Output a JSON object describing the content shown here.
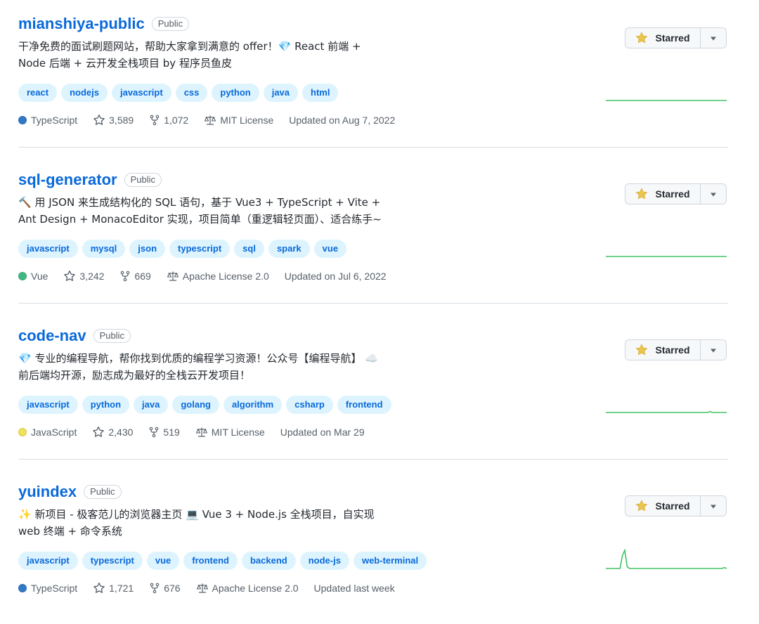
{
  "repos": [
    {
      "name": "mianshiya-public",
      "visibility": "Public",
      "description_line1": "干净免费的面试刷题网站，帮助大家拿到满意的 offer！💎 React 前端 +",
      "description_line2": "Node 后端 + 云开发全栈项目 by 程序员鱼皮",
      "topics": [
        "react",
        "nodejs",
        "javascript",
        "css",
        "python",
        "java",
        "html"
      ],
      "language": "TypeScript",
      "language_color": "#3178c6",
      "stars": "3,589",
      "forks": "1,072",
      "license": "MIT License",
      "updated": "Updated on Aug 7, 2022",
      "star_label": "Starred"
    },
    {
      "name": "sql-generator",
      "visibility": "Public",
      "description_line1": "🔨 用 JSON 来生成结构化的 SQL 语句，基于 Vue3 + TypeScript + Vite +",
      "description_line2": "Ant Design + MonacoEditor 实现，项目简单（重逻辑轻页面）、适合练手~",
      "topics": [
        "javascript",
        "mysql",
        "json",
        "typescript",
        "sql",
        "spark",
        "vue"
      ],
      "language": "Vue",
      "language_color": "#41b883",
      "stars": "3,242",
      "forks": "669",
      "license": "Apache License 2.0",
      "updated": "Updated on Jul 6, 2022",
      "star_label": "Starred"
    },
    {
      "name": "code-nav",
      "visibility": "Public",
      "description_line1": "💎 专业的编程导航，帮你找到优质的编程学习资源！公众号【编程导航】 ☁️",
      "description_line2": "前后端均开源，励志成为最好的全栈云开发项目！",
      "topics": [
        "javascript",
        "python",
        "java",
        "golang",
        "algorithm",
        "csharp",
        "frontend"
      ],
      "language": "JavaScript",
      "language_color": "#f1e05a",
      "stars": "2,430",
      "forks": "519",
      "license": "MIT License",
      "updated": "Updated on Mar 29",
      "star_label": "Starred"
    },
    {
      "name": "yuindex",
      "visibility": "Public",
      "description_line1": "✨ 新项目 - 极客范儿的浏览器主页 💻 Vue 3 + Node.js 全栈项目，自实现",
      "description_line2": "web 终端 + 命令系统",
      "topics": [
        "javascript",
        "typescript",
        "vue",
        "frontend",
        "backend",
        "node-js",
        "web-terminal"
      ],
      "language": "TypeScript",
      "language_color": "#3178c6",
      "stars": "1,721",
      "forks": "676",
      "license": "Apache License 2.0",
      "updated": "Updated last week",
      "star_label": "Starred"
    }
  ],
  "colors": {
    "link": "#0969da",
    "topic_bg": "#ddf4ff",
    "sparkline": "#40c463",
    "star_fill": "#eac54f"
  },
  "icons": {
    "star": "star-icon",
    "fork": "fork-icon",
    "license": "law-scale-icon",
    "dropdown": "triangle-down-icon"
  },
  "activity": [
    [
      0,
      0,
      0,
      0,
      0,
      0,
      0,
      0,
      0,
      0,
      0,
      0,
      0,
      0,
      0,
      0,
      0,
      0,
      0,
      0,
      0,
      0,
      0,
      0,
      0,
      0,
      0,
      0,
      0,
      0,
      0,
      0,
      0,
      0,
      0,
      0,
      0,
      0,
      0,
      0,
      0,
      0,
      0,
      0,
      0,
      0,
      0,
      0,
      0,
      0,
      0,
      0
    ],
    [
      0,
      0,
      0,
      0,
      0,
      0,
      0,
      0,
      0,
      0,
      0,
      0,
      0,
      0,
      0,
      0,
      0,
      0,
      0,
      0,
      0,
      0,
      0,
      0,
      0,
      0,
      0,
      0,
      0,
      0,
      0,
      0,
      0,
      0,
      0,
      0,
      0,
      0,
      0,
      0,
      0,
      0,
      0,
      0,
      0,
      0,
      0,
      0,
      0,
      0,
      0,
      0
    ],
    [
      0,
      0,
      0,
      0,
      0,
      0,
      0,
      0,
      0,
      0,
      0,
      0,
      0,
      0,
      0,
      0,
      0,
      0,
      0,
      0,
      0,
      0,
      0,
      0,
      0,
      0,
      0,
      0,
      0,
      0,
      0,
      0,
      0,
      0,
      0,
      0,
      0,
      0,
      0,
      0,
      0,
      0,
      0,
      0,
      1,
      0,
      0,
      0,
      0,
      0,
      0,
      0
    ],
    [
      0,
      0,
      0,
      0,
      0,
      0,
      0,
      14,
      20,
      2,
      0,
      0,
      0,
      0,
      0,
      0,
      0,
      0,
      0,
      0,
      0,
      0,
      0,
      0,
      0,
      0,
      0,
      0,
      0,
      0,
      0,
      0,
      0,
      0,
      0,
      0,
      0,
      0,
      0,
      0,
      0,
      0,
      0,
      0,
      0,
      0,
      0,
      0,
      0,
      0,
      1,
      0
    ]
  ]
}
